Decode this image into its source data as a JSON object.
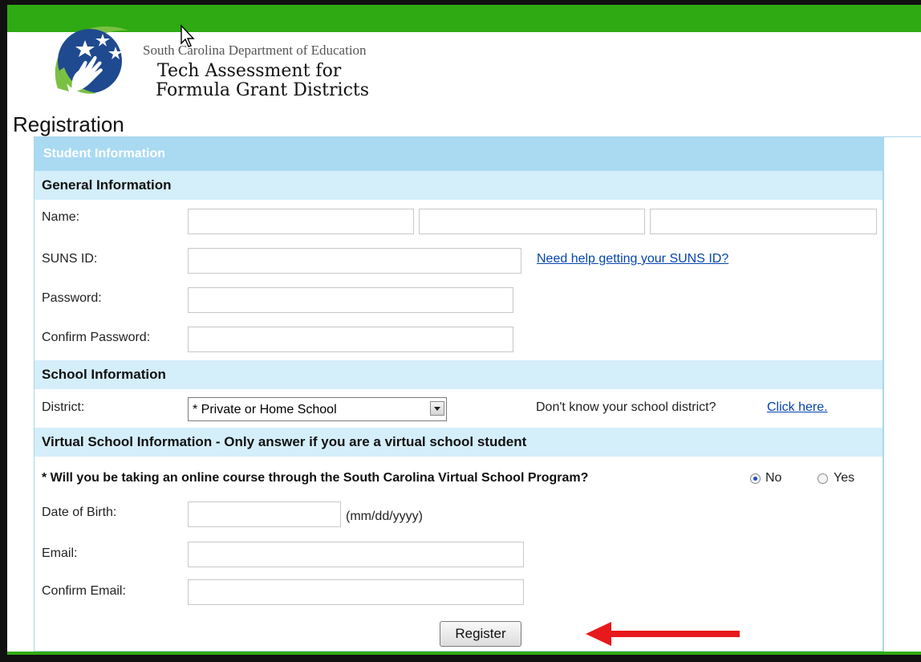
{
  "header": {
    "department": "South Carolina Department of Education",
    "title_line1": "Tech Assessment for",
    "title_line2": "Formula Grant Districts"
  },
  "page_title": "Registration",
  "form": {
    "section_title": "Student Information",
    "general": {
      "heading": "General Information",
      "name_label": "Name:",
      "suns_label": "SUNS ID:",
      "suns_help_link": "Need help getting your SUNS ID?",
      "password_label": "Password:",
      "confirm_password_label": "Confirm Password:"
    },
    "school": {
      "heading": "School Information",
      "district_label": "District:",
      "district_value": "* Private or Home School",
      "district_help_text": "Don't know your school district?",
      "district_help_link": "Click here."
    },
    "virtual": {
      "heading": "Virtual School Information - Only answer if you are a virtual school student",
      "question": "* Will you be taking an online course through the South Carolina Virtual School Program?",
      "option_no": "No",
      "option_yes": "Yes",
      "selected": "No",
      "dob_label": "Date of Birth:",
      "dob_hint": "(mm/dd/yyyy)",
      "email_label": "Email:",
      "confirm_email_label": "Confirm Email:"
    },
    "register_button": "Register"
  },
  "colors": {
    "top_bar": "#2faa12",
    "section_header": "#a9daf2",
    "sub_header": "#d4eefa",
    "link": "#0645ad",
    "annotation_arrow": "#e8191c"
  }
}
